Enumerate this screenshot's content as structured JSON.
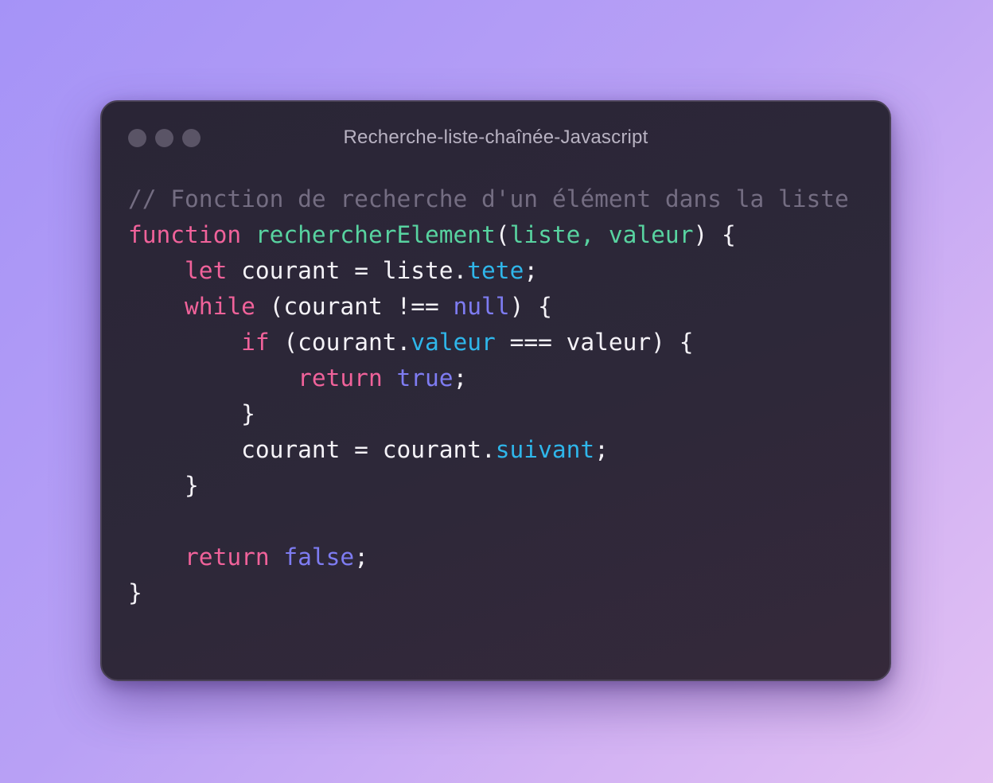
{
  "window": {
    "title": "Recherche-liste-chaînée-Javascript",
    "controls": [
      "close-dot",
      "minimize-dot",
      "maximize-dot"
    ]
  },
  "colors": {
    "comment": "#746d82",
    "keyword": "#f0629a",
    "function_name": "#58d3a0",
    "property": "#2fb6ea",
    "literal": "#7e7cf2",
    "plain": "#f4f2f7"
  },
  "code": {
    "language": "Javascript",
    "lines": [
      [
        {
          "t": "comment",
          "v": "// Fonction de recherche d'un élément dans la liste"
        }
      ],
      [
        {
          "t": "keyword",
          "v": "function"
        },
        {
          "t": "plain",
          "v": " "
        },
        {
          "t": "funcname",
          "v": "rechercherElement"
        },
        {
          "t": "punct",
          "v": "("
        },
        {
          "t": "param",
          "v": "liste, valeur"
        },
        {
          "t": "punct",
          "v": ") {"
        }
      ],
      [
        {
          "t": "plain",
          "v": "    "
        },
        {
          "t": "keyword",
          "v": "let"
        },
        {
          "t": "plain",
          "v": " courant = liste."
        },
        {
          "t": "prop",
          "v": "tete"
        },
        {
          "t": "punct",
          "v": ";"
        }
      ],
      [
        {
          "t": "plain",
          "v": "    "
        },
        {
          "t": "keyword",
          "v": "while"
        },
        {
          "t": "plain",
          "v": " (courant !== "
        },
        {
          "t": "literal",
          "v": "null"
        },
        {
          "t": "punct",
          "v": ") {"
        }
      ],
      [
        {
          "t": "plain",
          "v": "        "
        },
        {
          "t": "keyword",
          "v": "if"
        },
        {
          "t": "plain",
          "v": " (courant."
        },
        {
          "t": "prop",
          "v": "valeur"
        },
        {
          "t": "plain",
          "v": " === valeur) {"
        }
      ],
      [
        {
          "t": "plain",
          "v": "            "
        },
        {
          "t": "keyword",
          "v": "return"
        },
        {
          "t": "plain",
          "v": " "
        },
        {
          "t": "literal",
          "v": "true"
        },
        {
          "t": "punct",
          "v": ";"
        }
      ],
      [
        {
          "t": "plain",
          "v": "        }"
        }
      ],
      [
        {
          "t": "plain",
          "v": "        courant = courant."
        },
        {
          "t": "prop",
          "v": "suivant"
        },
        {
          "t": "punct",
          "v": ";"
        }
      ],
      [
        {
          "t": "plain",
          "v": "    }"
        }
      ],
      [],
      [
        {
          "t": "plain",
          "v": "    "
        },
        {
          "t": "keyword",
          "v": "return"
        },
        {
          "t": "plain",
          "v": " "
        },
        {
          "t": "literal",
          "v": "false"
        },
        {
          "t": "punct",
          "v": ";"
        }
      ],
      [
        {
          "t": "plain",
          "v": "}"
        }
      ]
    ]
  }
}
